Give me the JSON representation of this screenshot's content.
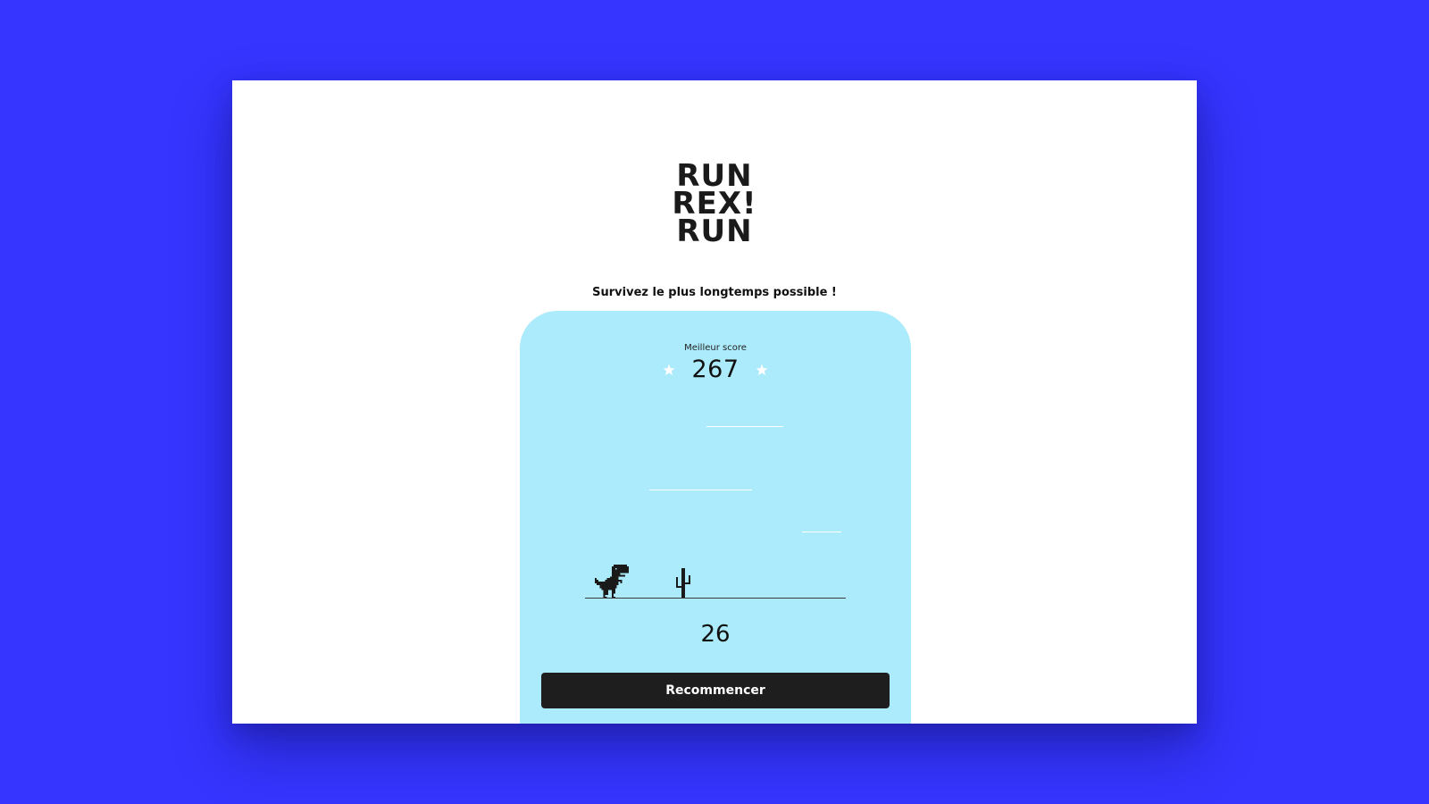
{
  "logo": {
    "line1": "RUN",
    "line2": "REX!",
    "line3": "RUN"
  },
  "subtitle": "Survivez le plus longtemps possible !",
  "best_score": {
    "label": "Meilleur score",
    "value": "267"
  },
  "current_score": "26",
  "restart_label": "Recommencer",
  "icons": {
    "star": "star-icon",
    "dino": "dino-icon",
    "cactus": "cactus-icon"
  },
  "colors": {
    "background": "#3535ff",
    "page": "#ffffff",
    "card": "#abebfb",
    "button": "#1e1e1e",
    "text": "#111111"
  }
}
